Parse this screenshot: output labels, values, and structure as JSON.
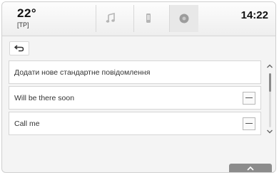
{
  "header": {
    "temperature": "22°",
    "temperature_sub": "[TP]",
    "clock": "14:22",
    "icons": [
      "music-icon",
      "phone-icon",
      "app-icon"
    ]
  },
  "toolbar": {
    "back_icon": "back-arrow-icon"
  },
  "messages": [
    {
      "label": "Додати нове стандартне повідомлення",
      "has_action": false
    },
    {
      "label": "Will be there soon",
      "has_action": true
    },
    {
      "label": "Call me",
      "has_action": true
    }
  ],
  "scroll": {
    "up_icon": "chevron-up-icon",
    "down_icon": "chevron-down-icon",
    "position_fraction": 0
  },
  "bottom": {
    "handle_icon": "chevron-up-icon"
  }
}
